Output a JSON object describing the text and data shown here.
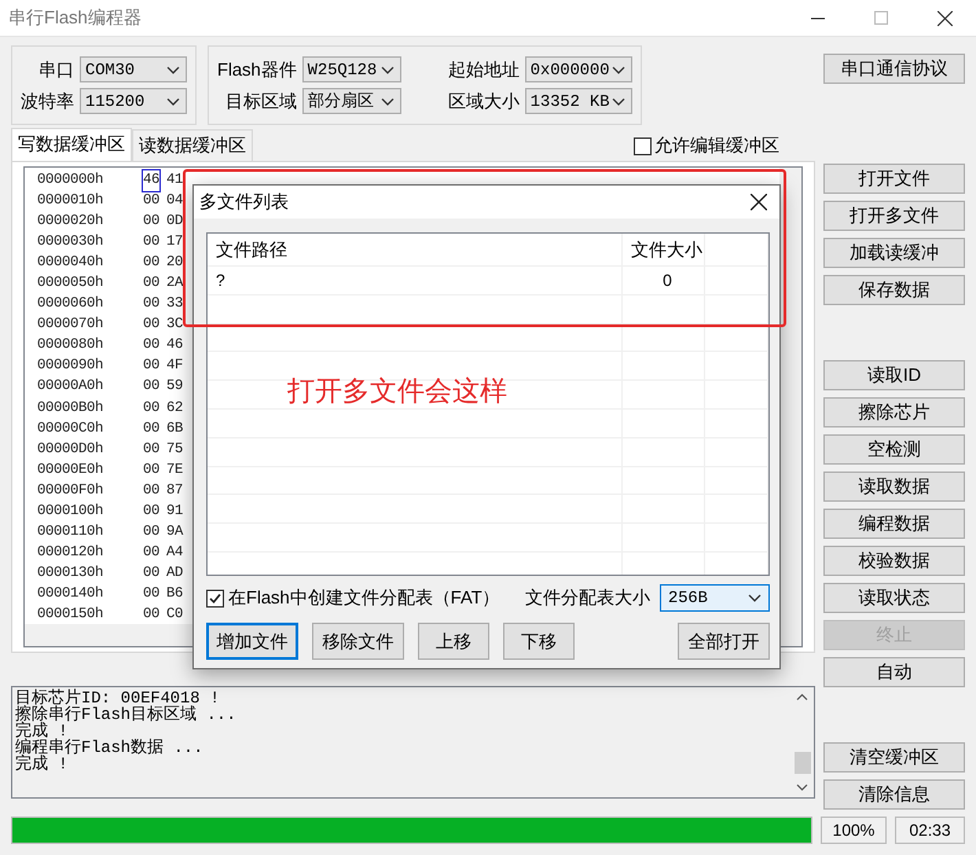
{
  "window": {
    "title": "串行Flash编程器"
  },
  "settings": [
    {
      "label": "串口",
      "value": "COM30"
    },
    {
      "label": "Flash器件",
      "value": "W25Q128"
    },
    {
      "label": "起始地址",
      "value": "0x000000"
    },
    {
      "label": "波特率",
      "value": "115200"
    },
    {
      "label": "目标区域",
      "value": "部分扇区"
    },
    {
      "label": "区域大小",
      "value": "13352 KB"
    }
  ],
  "protocol_button": "串口通信协议",
  "tabs": [
    {
      "label": "写数据缓冲区",
      "selected": true
    },
    {
      "label": "读数据缓冲区",
      "selected": false
    }
  ],
  "allow_edit": {
    "label": "允许编辑缓冲区",
    "checked": false
  },
  "hex_view": {
    "rows": [
      {
        "address": "0000000h",
        "byte_1": "46",
        "byte_2": "41",
        "selected": true
      },
      {
        "address": "0000010h",
        "byte_1": "00",
        "byte_2": "04",
        "selected": false
      },
      {
        "address": "0000020h",
        "byte_1": "00",
        "byte_2": "0D",
        "selected": false
      },
      {
        "address": "0000030h",
        "byte_1": "00",
        "byte_2": "17",
        "selected": false
      },
      {
        "address": "0000040h",
        "byte_1": "00",
        "byte_2": "20",
        "selected": false
      },
      {
        "address": "0000050h",
        "byte_1": "00",
        "byte_2": "2A",
        "selected": false
      },
      {
        "address": "0000060h",
        "byte_1": "00",
        "byte_2": "33",
        "selected": false
      },
      {
        "address": "0000070h",
        "byte_1": "00",
        "byte_2": "3C",
        "selected": false
      },
      {
        "address": "0000080h",
        "byte_1": "00",
        "byte_2": "46",
        "selected": false
      },
      {
        "address": "0000090h",
        "byte_1": "00",
        "byte_2": "4F",
        "selected": false
      },
      {
        "address": "00000A0h",
        "byte_1": "00",
        "byte_2": "59",
        "selected": false
      },
      {
        "address": "00000B0h",
        "byte_1": "00",
        "byte_2": "62",
        "selected": false
      },
      {
        "address": "00000C0h",
        "byte_1": "00",
        "byte_2": "6B",
        "selected": false
      },
      {
        "address": "00000D0h",
        "byte_1": "00",
        "byte_2": "75",
        "selected": false
      },
      {
        "address": "00000E0h",
        "byte_1": "00",
        "byte_2": "7E",
        "selected": false
      },
      {
        "address": "00000F0h",
        "byte_1": "00",
        "byte_2": "87",
        "selected": false
      },
      {
        "address": "0000100h",
        "byte_1": "00",
        "byte_2": "91",
        "selected": false
      },
      {
        "address": "0000110h",
        "byte_1": "00",
        "byte_2": "9A",
        "selected": false
      },
      {
        "address": "0000120h",
        "byte_1": "00",
        "byte_2": "A4",
        "selected": false
      },
      {
        "address": "0000130h",
        "byte_1": "00",
        "byte_2": "AD",
        "selected": false
      },
      {
        "address": "0000140h",
        "byte_1": "00",
        "byte_2": "B6",
        "selected": false
      },
      {
        "address": "0000150h",
        "byte_1": "00",
        "byte_2": "C0",
        "selected": false
      }
    ]
  },
  "file_buttons": [
    {
      "label": "打开文件"
    },
    {
      "label": "打开多文件"
    },
    {
      "label": "加载读缓冲"
    },
    {
      "label": "保存数据"
    }
  ],
  "chip_buttons": [
    {
      "label": "读取ID",
      "disabled": false
    },
    {
      "label": "擦除芯片",
      "disabled": false
    },
    {
      "label": "空检测",
      "disabled": false
    },
    {
      "label": "读取数据",
      "disabled": false
    },
    {
      "label": "编程数据",
      "disabled": false
    },
    {
      "label": "校验数据",
      "disabled": false
    },
    {
      "label": "读取状态",
      "disabled": false
    },
    {
      "label": "终止",
      "disabled": true
    },
    {
      "label": "自动",
      "disabled": false
    }
  ],
  "log": {
    "lines": [
      "目标芯片ID: 00EF4018 !",
      "擦除串行Flash目标区域 ...",
      "完成 !",
      "编程串行Flash数据 ...",
      "完成 !"
    ]
  },
  "log_buttons": [
    {
      "label": "清空缓冲区"
    },
    {
      "label": "清除信息"
    }
  ],
  "progress": {
    "level": 1,
    "percent": "100%",
    "time": "02:33"
  },
  "dialog": {
    "title": "多文件列表",
    "columns": [
      "文件路径",
      "文件大小"
    ],
    "rows": [
      {
        "path": "?",
        "size": "0"
      }
    ],
    "fat": {
      "label": "在Flash中创建文件分配表（FAT）",
      "checked": true
    },
    "fat_size": {
      "label": "文件分配表大小",
      "value": "256B"
    },
    "buttons": [
      {
        "label": "增加文件",
        "focused": true
      },
      {
        "label": "移除文件",
        "focused": false
      },
      {
        "label": "上移",
        "focused": false
      },
      {
        "label": "下移",
        "focused": false
      },
      {
        "label": "全部打开",
        "focused": false
      }
    ]
  },
  "annotation": {
    "text": "打开多文件会这样"
  }
}
